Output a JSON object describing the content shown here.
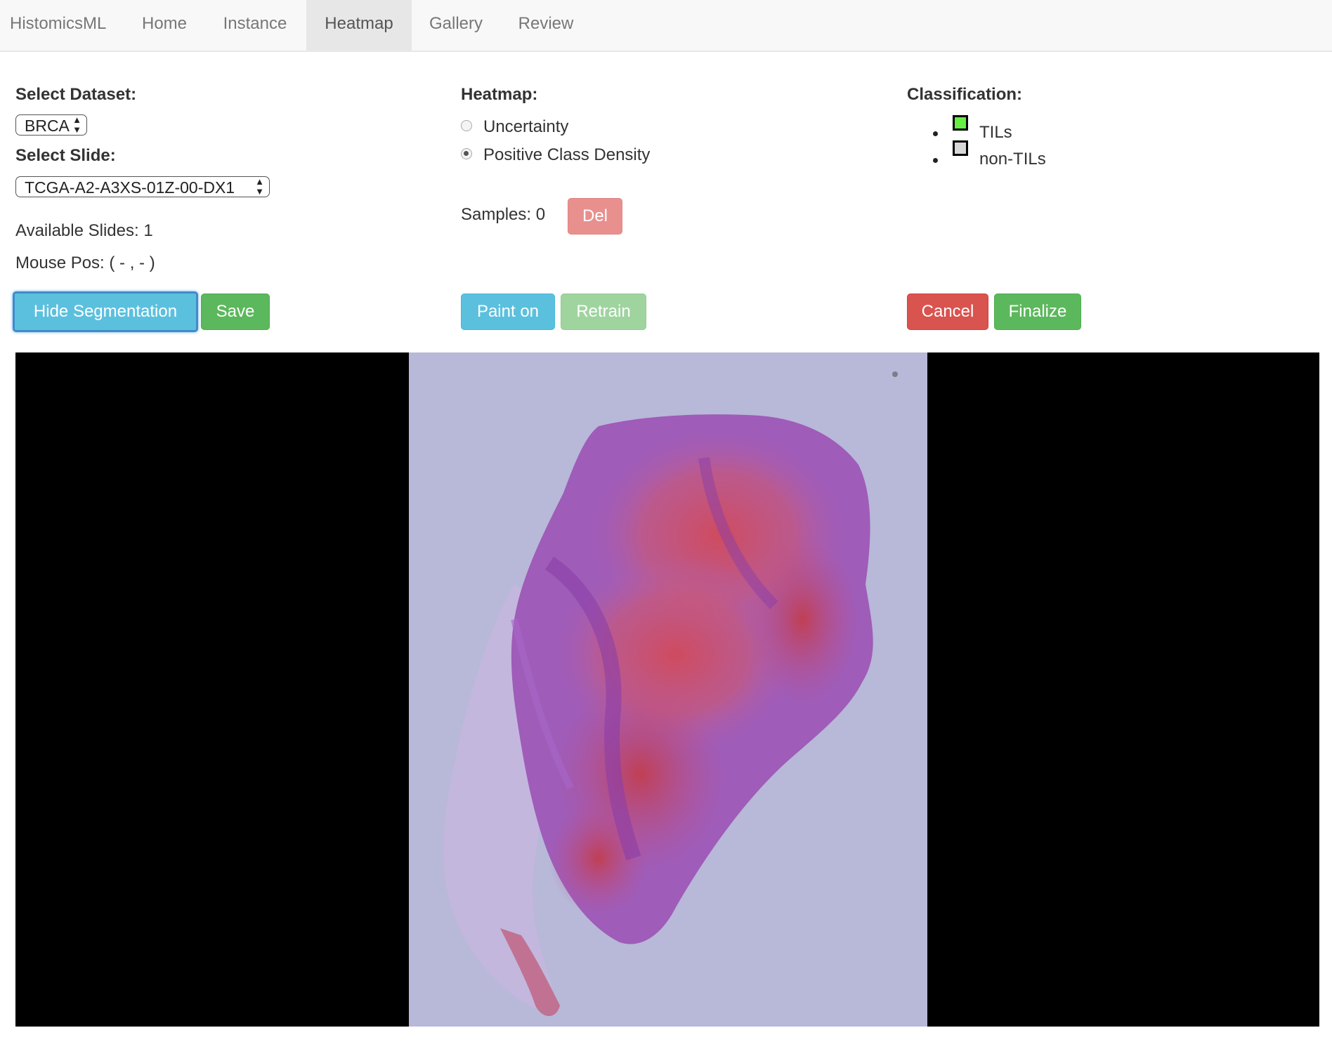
{
  "nav": {
    "brand": "HistomicsML",
    "items": [
      {
        "label": "Home"
      },
      {
        "label": "Instance"
      },
      {
        "label": "Heatmap",
        "active": true
      },
      {
        "label": "Gallery"
      },
      {
        "label": "Review"
      }
    ]
  },
  "dataset": {
    "label": "Select Dataset:",
    "value": "BRCA"
  },
  "slide": {
    "label": "Select Slide:",
    "value": "TCGA-A2-A3XS-01Z-00-DX1"
  },
  "available_slides": "Available Slides: 1",
  "mouse_pos": "Mouse Pos: ( - , - )",
  "heatmap": {
    "label": "Heatmap:",
    "options": [
      {
        "label": "Uncertainty",
        "checked": false
      },
      {
        "label": "Positive Class Density",
        "checked": true
      }
    ]
  },
  "samples": {
    "text": "Samples: 0",
    "del_label": "Del"
  },
  "classification": {
    "label": "Classification:",
    "classes": [
      {
        "label": "TILs",
        "color": "#66ee44"
      },
      {
        "label": "non-TILs",
        "color": "#d8d8d8"
      }
    ]
  },
  "buttons": {
    "hide_segmentation": "Hide Segmentation",
    "save": "Save",
    "paint_on": "Paint on",
    "retrain": "Retrain",
    "cancel": "Cancel",
    "finalize": "Finalize"
  },
  "colors": {
    "info": "#5bc0de",
    "success": "#5cb85c",
    "danger": "#d9534f",
    "slide_background": "#b8b8d9"
  }
}
